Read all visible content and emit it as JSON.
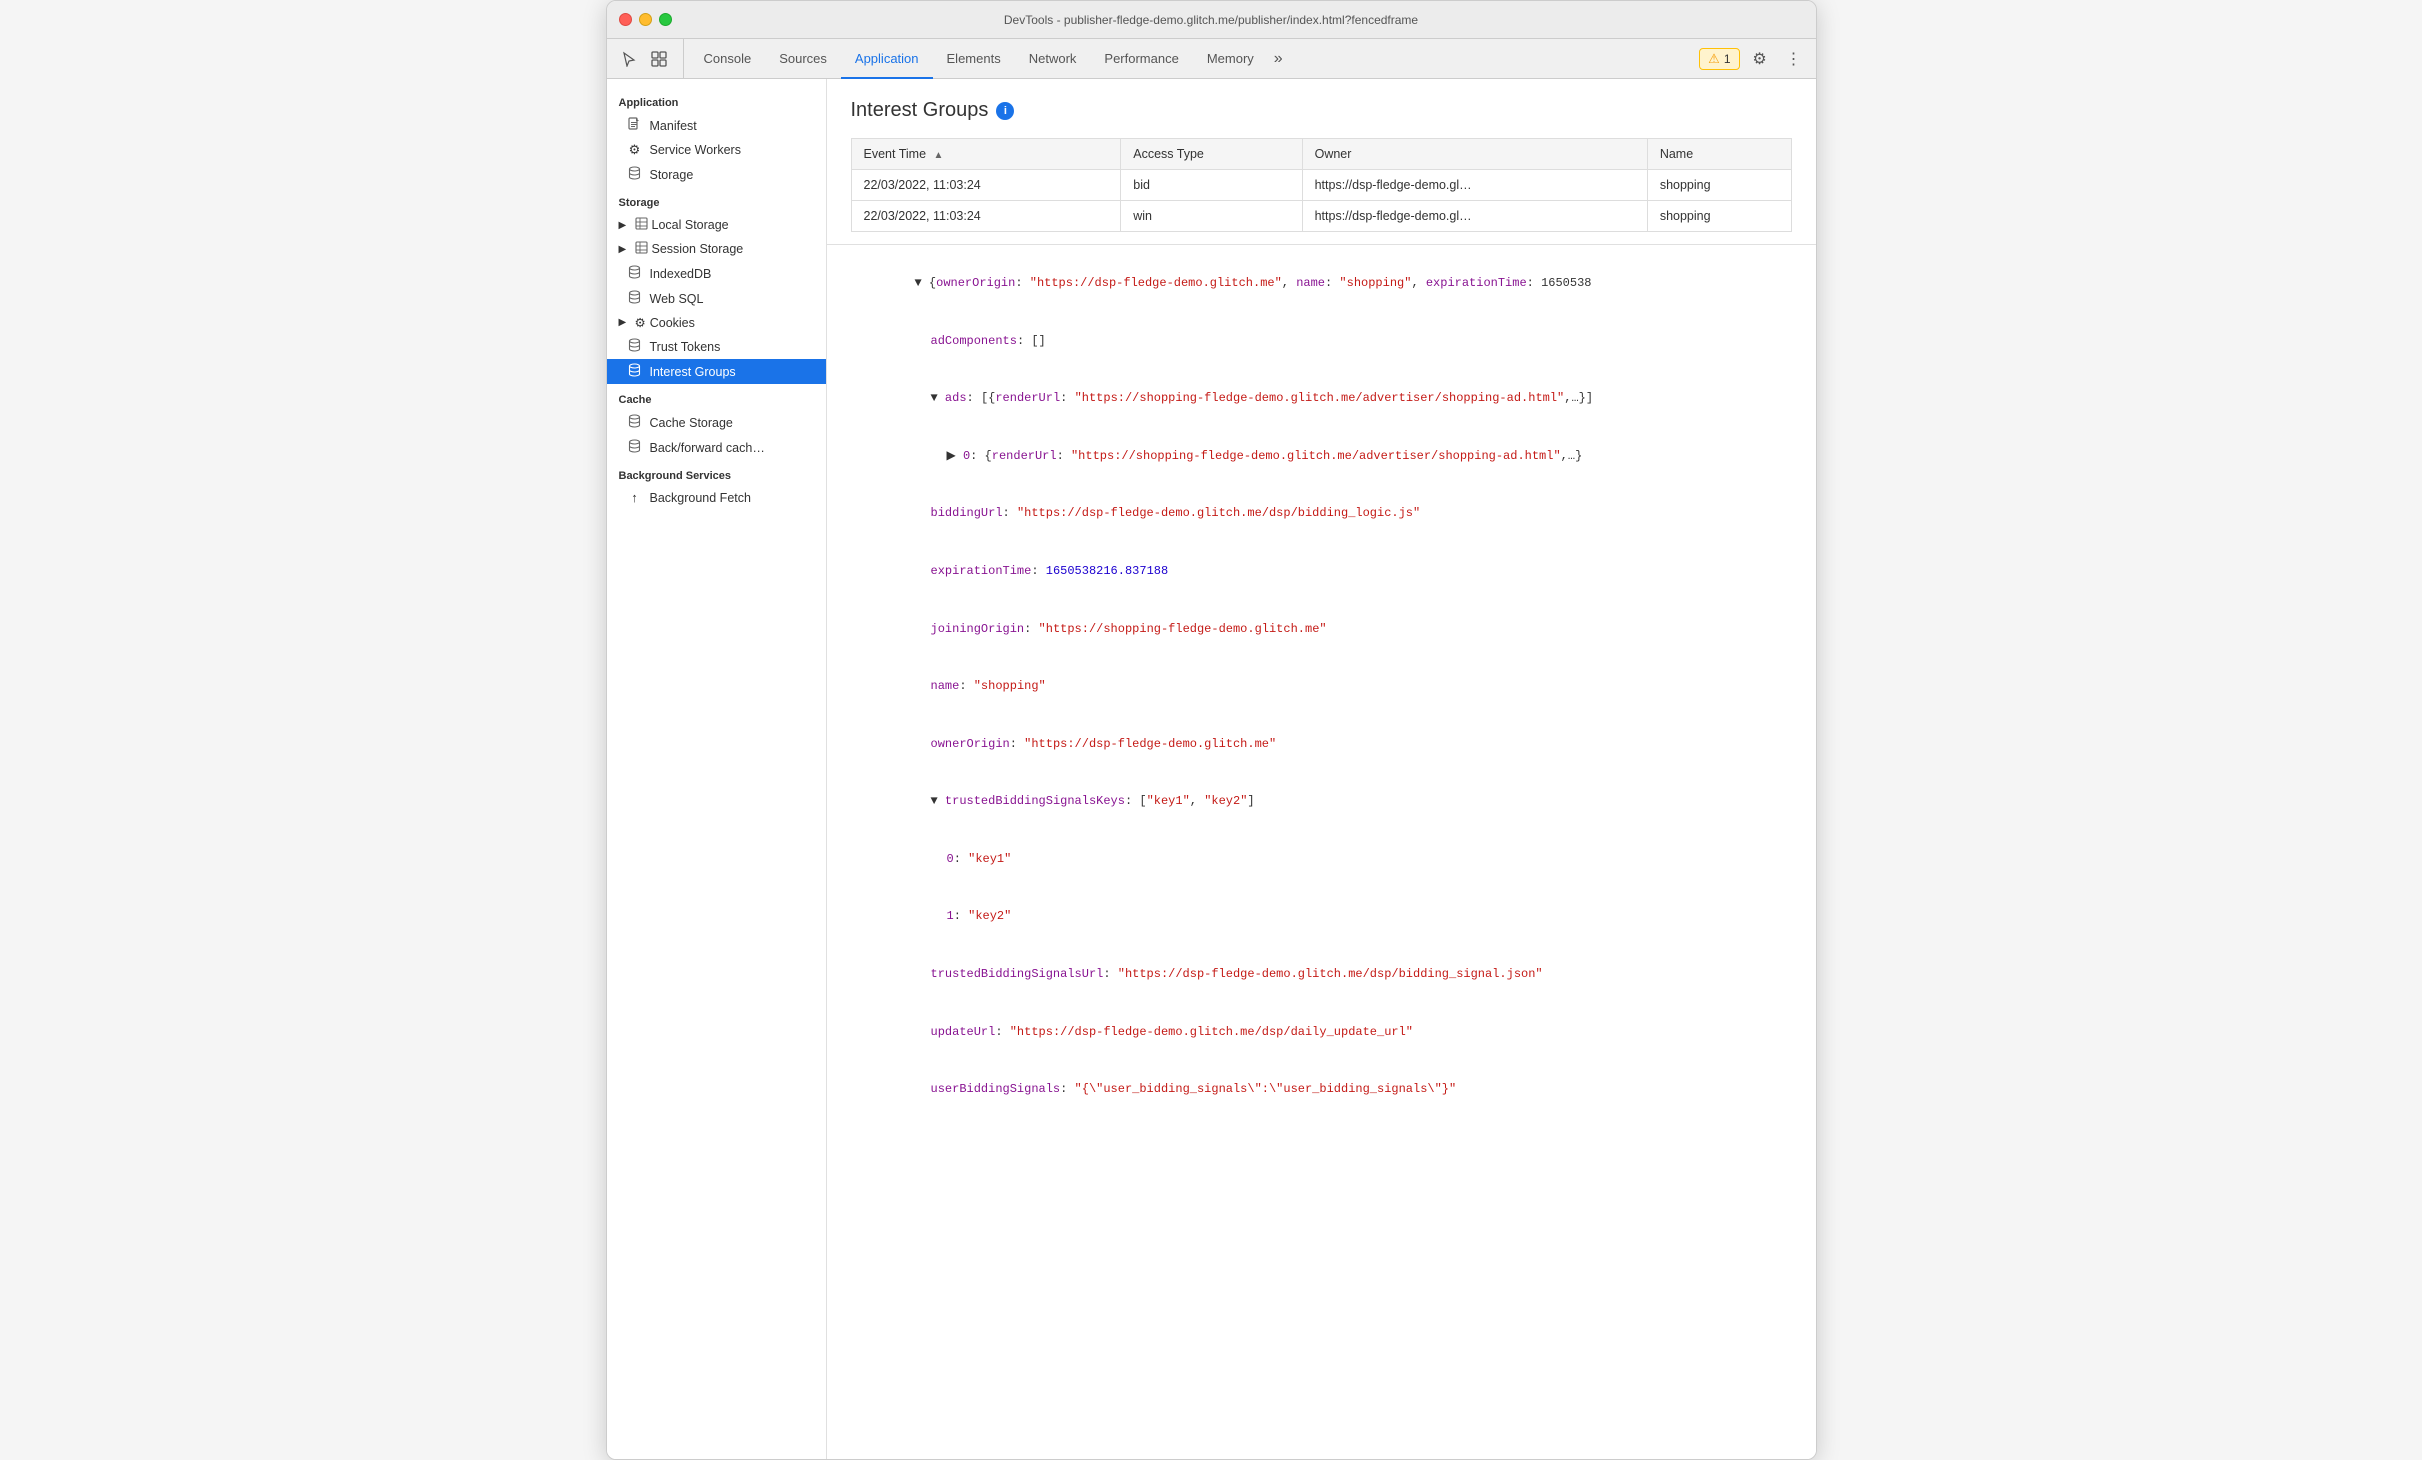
{
  "titleBar": {
    "title": "DevTools - publisher-fledge-demo.glitch.me/publisher/index.html?fencedframe"
  },
  "toolbar": {
    "tabs": [
      {
        "id": "console",
        "label": "Console",
        "active": false
      },
      {
        "id": "sources",
        "label": "Sources",
        "active": false
      },
      {
        "id": "application",
        "label": "Application",
        "active": true
      },
      {
        "id": "elements",
        "label": "Elements",
        "active": false
      },
      {
        "id": "network",
        "label": "Network",
        "active": false
      },
      {
        "id": "performance",
        "label": "Performance",
        "active": false
      },
      {
        "id": "memory",
        "label": "Memory",
        "active": false
      }
    ],
    "moreTabsLabel": "»",
    "warningCount": "1",
    "settingsIcon": "⚙",
    "moreIcon": "⋮"
  },
  "sidebar": {
    "sections": [
      {
        "id": "application",
        "title": "Application",
        "items": [
          {
            "id": "manifest",
            "label": "Manifest",
            "icon": "📄",
            "iconType": "file",
            "expandable": false,
            "active": false
          },
          {
            "id": "service-workers",
            "label": "Service Workers",
            "icon": "⚙",
            "iconType": "gear",
            "expandable": false,
            "active": false
          },
          {
            "id": "storage",
            "label": "Storage",
            "icon": "🗄",
            "iconType": "db",
            "expandable": false,
            "active": false
          }
        ]
      },
      {
        "id": "storage",
        "title": "Storage",
        "items": [
          {
            "id": "local-storage",
            "label": "Local Storage",
            "icon": "▶",
            "iconType": "expand",
            "expandable": true,
            "active": false
          },
          {
            "id": "session-storage",
            "label": "Session Storage",
            "icon": "▶",
            "iconType": "expand",
            "expandable": true,
            "active": false
          },
          {
            "id": "indexeddb",
            "label": "IndexedDB",
            "icon": "",
            "iconType": "db",
            "expandable": false,
            "active": false
          },
          {
            "id": "web-sql",
            "label": "Web SQL",
            "icon": "",
            "iconType": "db",
            "expandable": false,
            "active": false
          },
          {
            "id": "cookies",
            "label": "Cookies",
            "icon": "▶",
            "iconType": "expand",
            "expandable": true,
            "active": false
          },
          {
            "id": "trust-tokens",
            "label": "Trust Tokens",
            "icon": "",
            "iconType": "db",
            "expandable": false,
            "active": false
          },
          {
            "id": "interest-groups",
            "label": "Interest Groups",
            "icon": "",
            "iconType": "db",
            "expandable": false,
            "active": true
          }
        ]
      },
      {
        "id": "cache",
        "title": "Cache",
        "items": [
          {
            "id": "cache-storage",
            "label": "Cache Storage",
            "icon": "",
            "iconType": "db",
            "expandable": false,
            "active": false
          },
          {
            "id": "back-forward-cache",
            "label": "Back/forward cach…",
            "icon": "",
            "iconType": "db",
            "expandable": false,
            "active": false
          }
        ]
      },
      {
        "id": "background-services",
        "title": "Background Services",
        "items": [
          {
            "id": "background-fetch",
            "label": "Background Fetch",
            "icon": "▲",
            "iconType": "arrow",
            "expandable": false,
            "active": false
          }
        ]
      }
    ]
  },
  "interestGroups": {
    "title": "Interest Groups",
    "tableHeaders": [
      {
        "id": "event-time",
        "label": "Event Time",
        "sortable": true
      },
      {
        "id": "access-type",
        "label": "Access Type",
        "sortable": false
      },
      {
        "id": "owner",
        "label": "Owner",
        "sortable": false
      },
      {
        "id": "name",
        "label": "Name",
        "sortable": false
      }
    ],
    "tableRows": [
      {
        "eventTime": "22/03/2022, 11:03:24",
        "accessType": "bid",
        "owner": "https://dsp-fledge-demo.gl…",
        "name": "shopping"
      },
      {
        "eventTime": "22/03/2022, 11:03:24",
        "accessType": "win",
        "owner": "https://dsp-fledge-demo.gl…",
        "name": "shopping"
      }
    ]
  },
  "detailPanel": {
    "lines": [
      {
        "indent": 0,
        "type": "expandable-open",
        "content": "{ownerOrigin: \"https://dsp-fledge-demo.glitch.me\", name: \"shopping\", expirationTime: 1650538"
      },
      {
        "indent": 1,
        "type": "key-value",
        "key": "adComponents",
        "value": "[]"
      },
      {
        "indent": 1,
        "type": "expandable-open",
        "key": "ads",
        "value": "[{renderUrl: \"https://shopping-fledge-demo.glitch.me/advertiser/shopping-ad.html\",…}]"
      },
      {
        "indent": 2,
        "type": "expandable-open",
        "key": "▶ 0",
        "value": "{renderUrl: \"https://shopping-fledge-demo.glitch.me/advertiser/shopping-ad.html\",…}"
      },
      {
        "indent": 1,
        "type": "url-value",
        "key": "biddingUrl",
        "value": "\"https://dsp-fledge-demo.glitch.me/dsp/bidding_logic.js\""
      },
      {
        "indent": 1,
        "type": "number-value",
        "key": "expirationTime",
        "value": "1650538216.837188"
      },
      {
        "indent": 1,
        "type": "url-value",
        "key": "joiningOrigin",
        "value": "\"https://shopping-fledge-demo.glitch.me\""
      },
      {
        "indent": 1,
        "type": "string-value",
        "key": "name",
        "value": "\"shopping\""
      },
      {
        "indent": 1,
        "type": "url-value",
        "key": "ownerOrigin",
        "value": "\"https://dsp-fledge-demo.glitch.me\""
      },
      {
        "indent": 1,
        "type": "expandable-open",
        "key": "trustedBiddingSignalsKeys",
        "value": "[\"key1\", \"key2\"]"
      },
      {
        "indent": 2,
        "type": "string-value",
        "key": "0",
        "value": "\"key1\""
      },
      {
        "indent": 2,
        "type": "string-value",
        "key": "1",
        "value": "\"key2\""
      },
      {
        "indent": 1,
        "type": "url-value",
        "key": "trustedBiddingSignalsUrl",
        "value": "\"https://dsp-fledge-demo.glitch.me/dsp/bidding_signal.json\""
      },
      {
        "indent": 1,
        "type": "url-value",
        "key": "updateUrl",
        "value": "\"https://dsp-fledge-demo.glitch.me/dsp/daily_update_url\""
      },
      {
        "indent": 1,
        "type": "string-value",
        "key": "userBiddingSignals",
        "value": "\"{\\\"user_bidding_signals\\\":\\\"user_bidding_signals\\\"}\""
      }
    ]
  }
}
